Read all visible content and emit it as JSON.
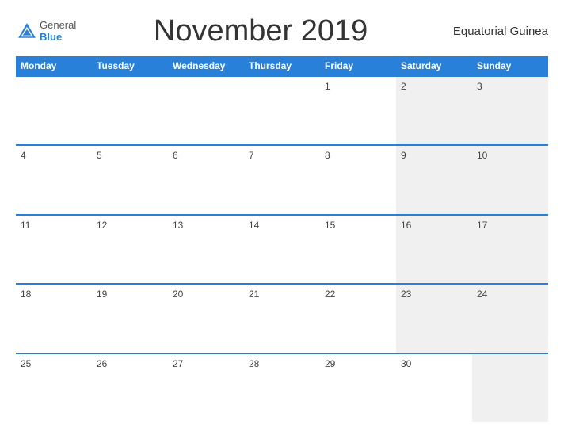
{
  "header": {
    "title": "November 2019",
    "country": "Equatorial Guinea",
    "logo_general": "General",
    "logo_blue": "Blue"
  },
  "weekdays": [
    "Monday",
    "Tuesday",
    "Wednesday",
    "Thursday",
    "Friday",
    "Saturday",
    "Sunday"
  ],
  "weeks": [
    [
      {
        "day": "",
        "shaded": false
      },
      {
        "day": "",
        "shaded": false
      },
      {
        "day": "",
        "shaded": false
      },
      {
        "day": "",
        "shaded": false
      },
      {
        "day": "1",
        "shaded": false
      },
      {
        "day": "2",
        "shaded": true
      },
      {
        "day": "3",
        "shaded": true
      }
    ],
    [
      {
        "day": "4",
        "shaded": false
      },
      {
        "day": "5",
        "shaded": false
      },
      {
        "day": "6",
        "shaded": false
      },
      {
        "day": "7",
        "shaded": false
      },
      {
        "day": "8",
        "shaded": false
      },
      {
        "day": "9",
        "shaded": true
      },
      {
        "day": "10",
        "shaded": true
      }
    ],
    [
      {
        "day": "11",
        "shaded": false
      },
      {
        "day": "12",
        "shaded": false
      },
      {
        "day": "13",
        "shaded": false
      },
      {
        "day": "14",
        "shaded": false
      },
      {
        "day": "15",
        "shaded": false
      },
      {
        "day": "16",
        "shaded": true
      },
      {
        "day": "17",
        "shaded": true
      }
    ],
    [
      {
        "day": "18",
        "shaded": false
      },
      {
        "day": "19",
        "shaded": false
      },
      {
        "day": "20",
        "shaded": false
      },
      {
        "day": "21",
        "shaded": false
      },
      {
        "day": "22",
        "shaded": false
      },
      {
        "day": "23",
        "shaded": true
      },
      {
        "day": "24",
        "shaded": true
      }
    ],
    [
      {
        "day": "25",
        "shaded": false
      },
      {
        "day": "26",
        "shaded": false
      },
      {
        "day": "27",
        "shaded": false
      },
      {
        "day": "28",
        "shaded": false
      },
      {
        "day": "29",
        "shaded": false
      },
      {
        "day": "30",
        "shaded": false
      },
      {
        "day": "",
        "shaded": true
      }
    ]
  ]
}
